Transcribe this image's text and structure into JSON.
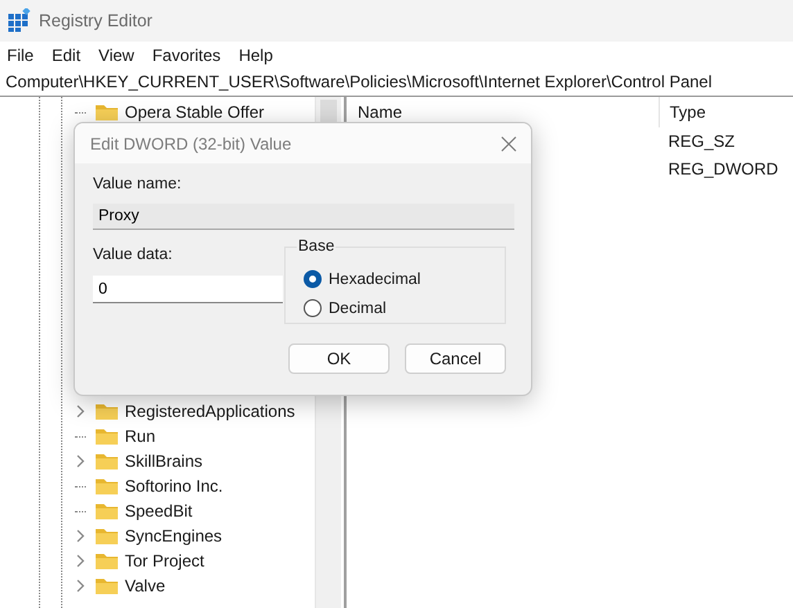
{
  "window": {
    "title": "Registry Editor"
  },
  "menu": [
    "File",
    "Edit",
    "View",
    "Favorites",
    "Help"
  ],
  "address": "Computer\\HKEY_CURRENT_USER\\Software\\Policies\\Microsoft\\Internet Explorer\\Control Panel",
  "tree": {
    "items_top": [
      {
        "label": "Opera Stable Offer",
        "expandable": false
      }
    ],
    "items_bottom": [
      {
        "label": "RegisteredApplications",
        "expandable": true
      },
      {
        "label": "Run",
        "expandable": false
      },
      {
        "label": "SkillBrains",
        "expandable": true
      },
      {
        "label": "Softorino Inc.",
        "expandable": false
      },
      {
        "label": "SpeedBit",
        "expandable": false
      },
      {
        "label": "SyncEngines",
        "expandable": true
      },
      {
        "label": "Tor Project",
        "expandable": true
      },
      {
        "label": "Valve",
        "expandable": true
      }
    ]
  },
  "values": {
    "columns": [
      "Name",
      "Type"
    ],
    "types": [
      "REG_SZ",
      "REG_DWORD"
    ]
  },
  "dialog": {
    "title": "Edit DWORD (32-bit) Value",
    "value_name_label": "Value name:",
    "value_name": "Proxy",
    "value_data_label": "Value data:",
    "value_data": "0",
    "base_label": "Base",
    "bases": [
      {
        "label": "Hexadecimal",
        "selected": true
      },
      {
        "label": "Decimal",
        "selected": false
      }
    ],
    "buttons": [
      "OK",
      "Cancel"
    ]
  }
}
